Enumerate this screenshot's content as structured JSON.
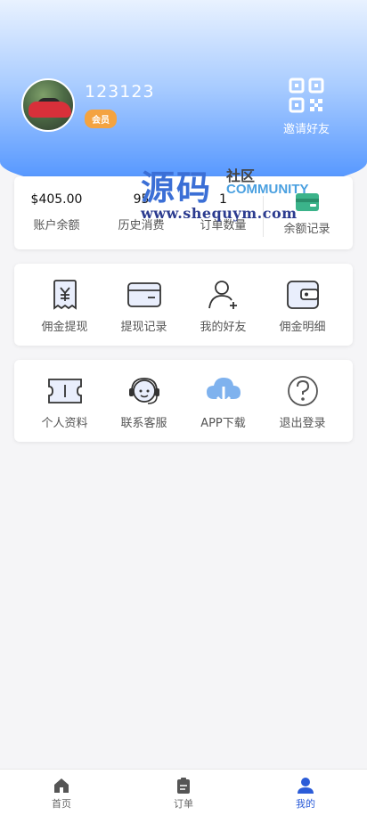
{
  "profile": {
    "username": "123123",
    "badge": "会员",
    "invite_label": "邀请好友"
  },
  "stats": [
    {
      "value": "$405.00",
      "label": "账户余额"
    },
    {
      "value": "95",
      "label": "历史消费"
    },
    {
      "value": "1",
      "label": "订单数量"
    },
    {
      "value": "",
      "label": "余额记录"
    }
  ],
  "menu_row1": [
    {
      "label": "佣金提现",
      "icon": "yen-receipt-icon"
    },
    {
      "label": "提现记录",
      "icon": "card-icon"
    },
    {
      "label": "我的好友",
      "icon": "add-friend-icon"
    },
    {
      "label": "佣金明细",
      "icon": "wallet-icon"
    }
  ],
  "menu_row2": [
    {
      "label": "个人资料",
      "icon": "ticket-icon"
    },
    {
      "label": "联系客服",
      "icon": "headset-icon"
    },
    {
      "label": "APP下载",
      "icon": "cloud-download-icon"
    },
    {
      "label": "退出登录",
      "icon": "help-circle-icon"
    }
  ],
  "watermark": {
    "big": "源码",
    "small": "社区",
    "community": "COMMUNITY",
    "url": "www.shequym.com"
  },
  "tabbar": [
    {
      "label": "首页",
      "icon": "home-icon",
      "active": false
    },
    {
      "label": "订单",
      "icon": "order-icon",
      "active": false
    },
    {
      "label": "我的",
      "icon": "user-icon",
      "active": true
    }
  ],
  "colors": {
    "accent": "#2b5cd8",
    "header_top": "#e9f2ff",
    "header_bottom": "#4a90ff",
    "badge": "#f4a340"
  }
}
